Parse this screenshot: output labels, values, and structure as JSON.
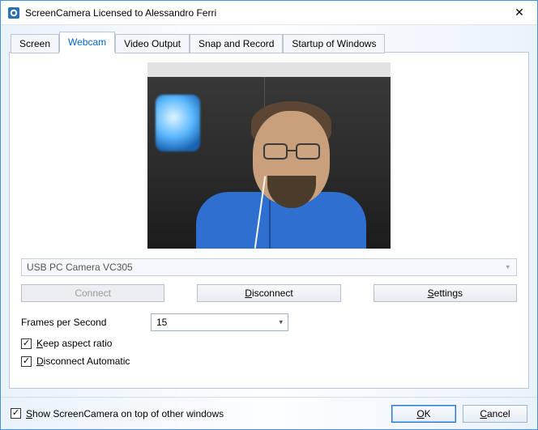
{
  "window": {
    "title": "ScreenCamera Licensed to Alessandro Ferri",
    "close_glyph": "✕"
  },
  "tabs": [
    {
      "label": "Screen"
    },
    {
      "label": "Webcam"
    },
    {
      "label": "Video Output"
    },
    {
      "label": "Snap and Record"
    },
    {
      "label": "Startup of Windows"
    }
  ],
  "webcam": {
    "device": "USB PC Camera VC305",
    "connect_label": "Connect",
    "disconnect_prefix": "D",
    "disconnect_rest": "isconnect",
    "settings_prefix": "S",
    "settings_rest": "ettings",
    "fps_label": "Frames per Second",
    "fps_value": "15",
    "keep_aspect_prefix": "K",
    "keep_aspect_rest": "eep aspect ratio",
    "disconnect_auto_prefix": "D",
    "disconnect_auto_rest": "isconnect Automatic"
  },
  "footer": {
    "show_on_top_prefix": "S",
    "show_on_top_rest": "how ScreenCamera on top of other windows",
    "ok_prefix": "O",
    "ok_rest": "K",
    "cancel_prefix": "C",
    "cancel_rest": "ancel"
  },
  "check_glyph": "✓"
}
